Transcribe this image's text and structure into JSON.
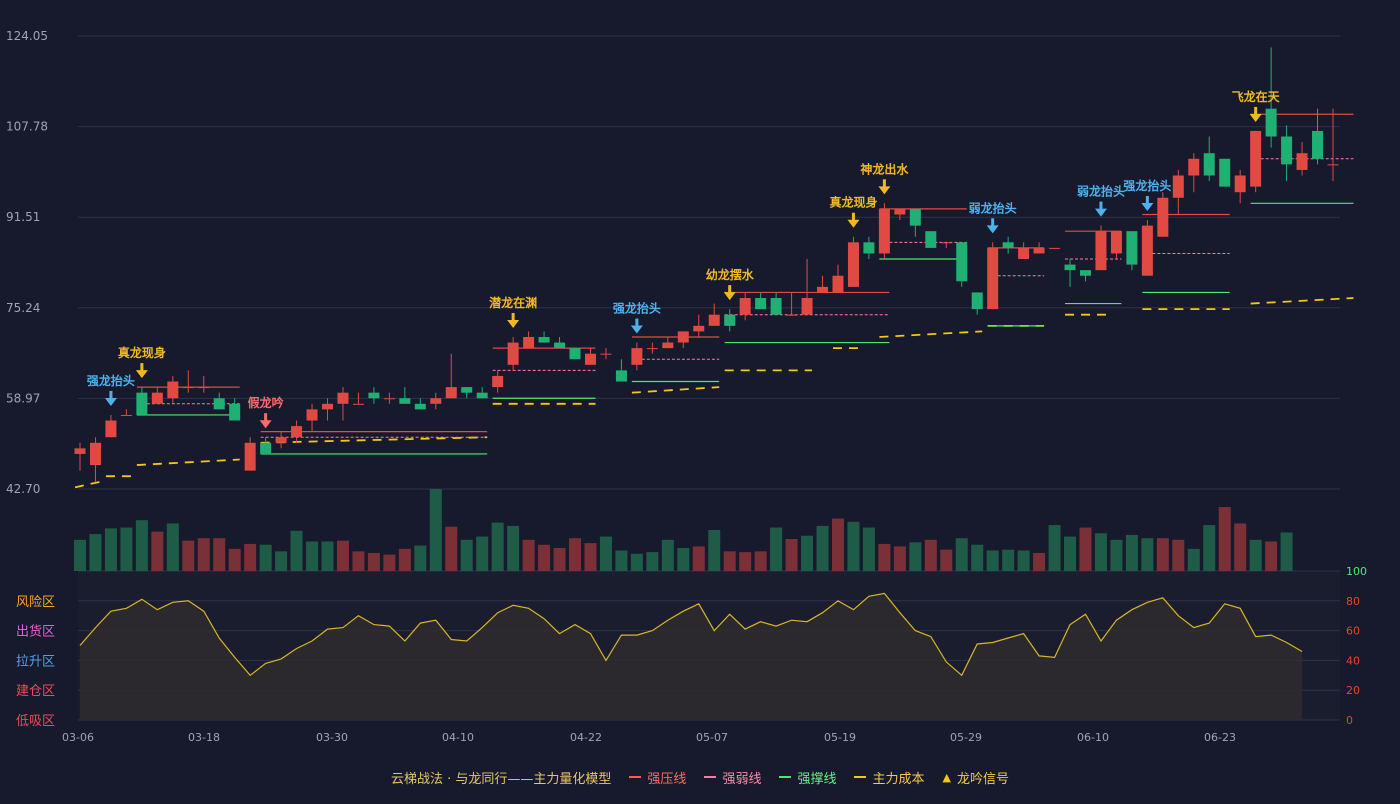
{
  "colors": {
    "background": "#171a2c",
    "grid": "#2e3248",
    "up": "#e04a43",
    "down": "#20b074",
    "vol_up": "#7b3037",
    "vol_down": "#1f5c47",
    "signal_gold": "#f2b824",
    "signal_blue": "#4fb0ec",
    "signal_red": "#ff6b6b",
    "pressure_line": "#e24a45",
    "weak_line": "#ff7aa2",
    "support_line": "#4ee86f",
    "cost_line": "#f5c517",
    "osc_line": "#d8b526",
    "osc_fill": "#2f2c2d",
    "axis_text": "#9fa3b5",
    "right_axis_text": "#e8432f",
    "right_axis_top": "#4ee86f"
  },
  "chart_data": {
    "type": "candlestick",
    "price_axis": {
      "ticks": [
        "124.05",
        "107.78",
        "91.51",
        "75.24",
        "58.97",
        "42.70"
      ],
      "ylim": [
        42.7,
        124.05
      ]
    },
    "x_ticks": [
      "03-06",
      "03-18",
      "03-30",
      "04-10",
      "04-22",
      "05-07",
      "05-19",
      "05-29",
      "06-10",
      "06-23"
    ],
    "candles": [
      [
        49,
        50,
        46,
        51
      ],
      [
        47,
        51,
        44,
        52
      ],
      [
        52,
        55,
        52,
        56
      ],
      [
        56,
        56,
        56,
        57
      ],
      [
        60,
        56,
        56,
        61
      ],
      [
        58,
        60,
        58,
        61
      ],
      [
        59,
        62,
        58,
        63
      ],
      [
        61,
        61,
        60,
        64
      ],
      [
        61,
        61,
        60,
        63
      ],
      [
        59,
        57,
        57,
        60
      ],
      [
        58,
        55,
        55,
        59
      ],
      [
        46,
        51,
        46,
        52
      ],
      [
        51,
        49,
        49,
        52
      ],
      [
        51,
        52,
        50,
        53
      ],
      [
        52,
        54,
        51,
        55
      ],
      [
        55,
        57,
        53,
        58
      ],
      [
        57,
        58,
        55,
        59
      ],
      [
        58,
        60,
        55,
        61
      ],
      [
        58,
        58,
        58,
        60
      ],
      [
        60,
        59,
        58,
        61
      ],
      [
        59,
        59,
        58,
        60
      ],
      [
        59,
        58,
        58,
        61
      ],
      [
        58,
        57,
        57,
        59
      ],
      [
        58,
        59,
        57,
        60
      ],
      [
        59,
        61,
        59,
        67
      ],
      [
        61,
        60,
        59,
        61
      ],
      [
        60,
        59,
        59,
        61
      ],
      [
        61,
        63,
        60,
        64
      ],
      [
        65,
        69,
        64,
        70
      ],
      [
        68,
        70,
        68,
        71
      ],
      [
        70,
        69,
        69,
        71
      ],
      [
        69,
        68,
        68,
        70
      ],
      [
        68,
        66,
        66,
        68
      ],
      [
        65,
        67,
        65,
        68
      ],
      [
        67,
        67,
        66,
        68
      ],
      [
        64,
        62,
        62,
        66
      ],
      [
        65,
        68,
        64,
        69
      ],
      [
        68,
        68,
        67,
        69
      ],
      [
        68,
        69,
        68,
        70
      ],
      [
        69,
        71,
        68,
        71
      ],
      [
        71,
        72,
        70,
        74
      ],
      [
        72,
        74,
        72,
        76
      ],
      [
        74,
        72,
        71,
        75
      ],
      [
        74,
        77,
        73,
        78
      ],
      [
        77,
        75,
        75,
        78
      ],
      [
        77,
        74,
        74,
        78
      ],
      [
        74,
        74,
        74,
        78
      ],
      [
        74,
        77,
        74,
        84
      ],
      [
        78,
        79,
        78,
        81
      ],
      [
        78,
        81,
        78,
        83
      ],
      [
        79,
        87,
        79,
        88
      ],
      [
        87,
        85,
        84,
        88
      ],
      [
        85,
        93,
        84,
        94
      ],
      [
        92,
        93,
        91,
        93
      ],
      [
        93,
        90,
        88,
        93
      ],
      [
        89,
        86,
        86,
        89
      ],
      [
        87,
        87,
        86,
        87
      ],
      [
        87,
        80,
        79,
        87
      ],
      [
        78,
        75,
        74,
        78
      ],
      [
        75,
        86,
        75,
        87
      ],
      [
        87,
        86,
        85,
        88
      ],
      [
        84,
        86,
        84,
        87
      ],
      [
        85,
        86,
        85,
        87
      ],
      [
        86,
        86,
        86,
        86
      ],
      [
        83,
        82,
        79,
        84
      ],
      [
        82,
        81,
        80,
        82
      ],
      [
        82,
        89,
        82,
        90
      ],
      [
        85,
        89,
        84,
        89
      ],
      [
        89,
        83,
        82,
        89
      ],
      [
        81,
        90,
        81,
        91
      ],
      [
        88,
        95,
        88,
        96
      ],
      [
        95,
        99,
        92,
        100
      ],
      [
        99,
        102,
        96,
        103
      ],
      [
        103,
        99,
        98,
        106
      ],
      [
        102,
        97,
        97,
        102
      ],
      [
        96,
        99,
        94,
        100
      ],
      [
        97,
        107,
        96,
        107
      ],
      [
        111,
        106,
        104,
        122
      ],
      [
        106,
        101,
        98,
        108
      ],
      [
        100,
        103,
        99,
        105
      ],
      [
        107,
        102,
        101,
        111
      ],
      [
        101,
        101,
        98,
        111
      ]
    ],
    "volume": [
      [
        0.38,
        "d"
      ],
      [
        0.45,
        "d"
      ],
      [
        0.52,
        "d"
      ],
      [
        0.53,
        "d"
      ],
      [
        0.62,
        "d"
      ],
      [
        0.48,
        "u"
      ],
      [
        0.58,
        "d"
      ],
      [
        0.37,
        "u"
      ],
      [
        0.4,
        "u"
      ],
      [
        0.4,
        "u"
      ],
      [
        0.27,
        "u"
      ],
      [
        0.33,
        "u"
      ],
      [
        0.32,
        "d"
      ],
      [
        0.24,
        "d"
      ],
      [
        0.49,
        "d"
      ],
      [
        0.36,
        "d"
      ],
      [
        0.36,
        "d"
      ],
      [
        0.37,
        "u"
      ],
      [
        0.24,
        "u"
      ],
      [
        0.22,
        "u"
      ],
      [
        0.2,
        "u"
      ],
      [
        0.27,
        "u"
      ],
      [
        0.31,
        "d"
      ],
      [
        1.0,
        "d"
      ],
      [
        0.54,
        "u"
      ],
      [
        0.38,
        "d"
      ],
      [
        0.42,
        "d"
      ],
      [
        0.59,
        "d"
      ],
      [
        0.55,
        "d"
      ],
      [
        0.38,
        "u"
      ],
      [
        0.32,
        "u"
      ],
      [
        0.28,
        "u"
      ],
      [
        0.4,
        "u"
      ],
      [
        0.34,
        "u"
      ],
      [
        0.42,
        "d"
      ],
      [
        0.25,
        "d"
      ],
      [
        0.21,
        "d"
      ],
      [
        0.23,
        "d"
      ],
      [
        0.38,
        "d"
      ],
      [
        0.28,
        "d"
      ],
      [
        0.3,
        "u"
      ],
      [
        0.5,
        "d"
      ],
      [
        0.24,
        "u"
      ],
      [
        0.23,
        "u"
      ],
      [
        0.24,
        "u"
      ],
      [
        0.53,
        "d"
      ],
      [
        0.39,
        "u"
      ],
      [
        0.43,
        "d"
      ],
      [
        0.55,
        "d"
      ],
      [
        0.64,
        "u"
      ],
      [
        0.6,
        "d"
      ],
      [
        0.53,
        "d"
      ],
      [
        0.33,
        "u"
      ],
      [
        0.3,
        "u"
      ],
      [
        0.35,
        "d"
      ],
      [
        0.38,
        "u"
      ],
      [
        0.26,
        "u"
      ],
      [
        0.4,
        "d"
      ],
      [
        0.32,
        "d"
      ],
      [
        0.25,
        "d"
      ],
      [
        0.26,
        "d"
      ],
      [
        0.25,
        "d"
      ],
      [
        0.22,
        "u"
      ],
      [
        0.56,
        "d"
      ],
      [
        0.42,
        "d"
      ],
      [
        0.53,
        "u"
      ],
      [
        0.46,
        "d"
      ],
      [
        0.38,
        "d"
      ],
      [
        0.44,
        "d"
      ],
      [
        0.4,
        "d"
      ],
      [
        0.4,
        "u"
      ],
      [
        0.38,
        "u"
      ],
      [
        0.27,
        "d"
      ],
      [
        0.56,
        "d"
      ],
      [
        0.78,
        "u"
      ],
      [
        0.58,
        "u"
      ],
      [
        0.38,
        "d"
      ],
      [
        0.36,
        "u"
      ],
      [
        0.47,
        "d"
      ]
    ],
    "oscillator": [
      50,
      62,
      73,
      75,
      81,
      74,
      79,
      80,
      73,
      55,
      42,
      30,
      38,
      41,
      48,
      53,
      61,
      62,
      70,
      64,
      63,
      53,
      65,
      67,
      54,
      53,
      62,
      72,
      77,
      75,
      68,
      58,
      64,
      58,
      40,
      57,
      57,
      60,
      67,
      73,
      78,
      60,
      71,
      61,
      66,
      63,
      67,
      66,
      72,
      80,
      74,
      83,
      85,
      72,
      60,
      56,
      39,
      30,
      51,
      52,
      55,
      58,
      43,
      42,
      64,
      71,
      53,
      67,
      74,
      79,
      82,
      70,
      62,
      65,
      78,
      75,
      56,
      57,
      52,
      46
    ],
    "osc_axis": {
      "ticks_right": [
        "100",
        "80",
        "60",
        "40",
        "20",
        "0"
      ]
    },
    "zones": [
      {
        "label": "风险区",
        "color": "#f5a623"
      },
      {
        "label": "出货区",
        "color": "#e05ed1"
      },
      {
        "label": "拉升区",
        "color": "#4aa3f0"
      },
      {
        "label": "建仓区",
        "color": "#ef4a57"
      },
      {
        "label": "低吸区",
        "color": "#ef4a57"
      }
    ],
    "pressure_lines": [
      [
        4,
        10,
        61
      ],
      [
        12,
        26,
        53
      ],
      [
        27,
        33,
        68
      ],
      [
        36,
        41,
        70
      ],
      [
        42,
        52,
        78
      ],
      [
        52,
        57,
        93
      ],
      [
        59,
        62,
        86
      ],
      [
        64,
        67,
        89
      ],
      [
        69,
        74,
        92
      ],
      [
        76,
        82,
        110
      ]
    ],
    "weak_lines": [
      [
        4,
        10,
        58
      ],
      [
        12,
        26,
        52
      ],
      [
        27,
        33,
        64
      ],
      [
        36,
        41,
        66
      ],
      [
        42,
        52,
        74
      ],
      [
        52,
        57,
        87
      ],
      [
        59,
        62,
        81
      ],
      [
        64,
        67,
        84
      ],
      [
        69,
        74,
        85
      ],
      [
        76,
        82,
        102
      ]
    ],
    "support_lines": [
      [
        4,
        10,
        56
      ],
      [
        12,
        26,
        49
      ],
      [
        27,
        33,
        59
      ],
      [
        36,
        41,
        62
      ],
      [
        42,
        52,
        69
      ],
      [
        52,
        57,
        84
      ],
      [
        59,
        62,
        72
      ],
      [
        64,
        67,
        76
      ],
      [
        69,
        74,
        78
      ],
      [
        76,
        82,
        94
      ]
    ],
    "cost_segments": [
      [
        0,
        1,
        43,
        44
      ],
      [
        2,
        3,
        45,
        45
      ],
      [
        4,
        10,
        47,
        48
      ],
      [
        12,
        26,
        51,
        52
      ],
      [
        27,
        33,
        58,
        58
      ],
      [
        36,
        41,
        60,
        61
      ],
      [
        42,
        47,
        64,
        64
      ],
      [
        49,
        50,
        68,
        68
      ],
      [
        52,
        58,
        70,
        71
      ],
      [
        59,
        62,
        72,
        72
      ],
      [
        64,
        66,
        74,
        74
      ],
      [
        69,
        74,
        75,
        75
      ],
      [
        76,
        82,
        76,
        77
      ]
    ],
    "signals": [
      {
        "i": 2,
        "label": "强龙抬头",
        "color": "blue"
      },
      {
        "i": 4,
        "label": "真龙现身",
        "color": "gold"
      },
      {
        "i": 12,
        "label": "假龙吟",
        "color": "red"
      },
      {
        "i": 28,
        "label": "潜龙在渊",
        "color": "gold"
      },
      {
        "i": 36,
        "label": "强龙抬头",
        "color": "blue"
      },
      {
        "i": 42,
        "label": "幼龙摆水",
        "color": "gold"
      },
      {
        "i": 50,
        "label": "真龙现身",
        "color": "gold"
      },
      {
        "i": 52,
        "label": "神龙出水",
        "color": "gold"
      },
      {
        "i": 59,
        "label": "弱龙抬头",
        "color": "blue"
      },
      {
        "i": 66,
        "label": "弱龙抬头",
        "color": "blue"
      },
      {
        "i": 69,
        "label": "强龙抬头",
        "color": "blue"
      },
      {
        "i": 76,
        "label": "飞龙在天",
        "color": "gold"
      }
    ]
  },
  "legend": {
    "model": "云梯战法 · 与龙同行——主力量化模型",
    "items": [
      {
        "label": "强压线",
        "color": "#ff5a4f",
        "style": "solid"
      },
      {
        "label": "强弱线",
        "color": "#ff7aa2",
        "style": "dashed"
      },
      {
        "label": "强撑线",
        "color": "#4ee86f",
        "style": "solid"
      },
      {
        "label": "主力成本",
        "color": "#f5c517",
        "style": "dashed"
      },
      {
        "label": "龙吟信号",
        "color": "#f5c517",
        "style": "triangle"
      }
    ]
  }
}
